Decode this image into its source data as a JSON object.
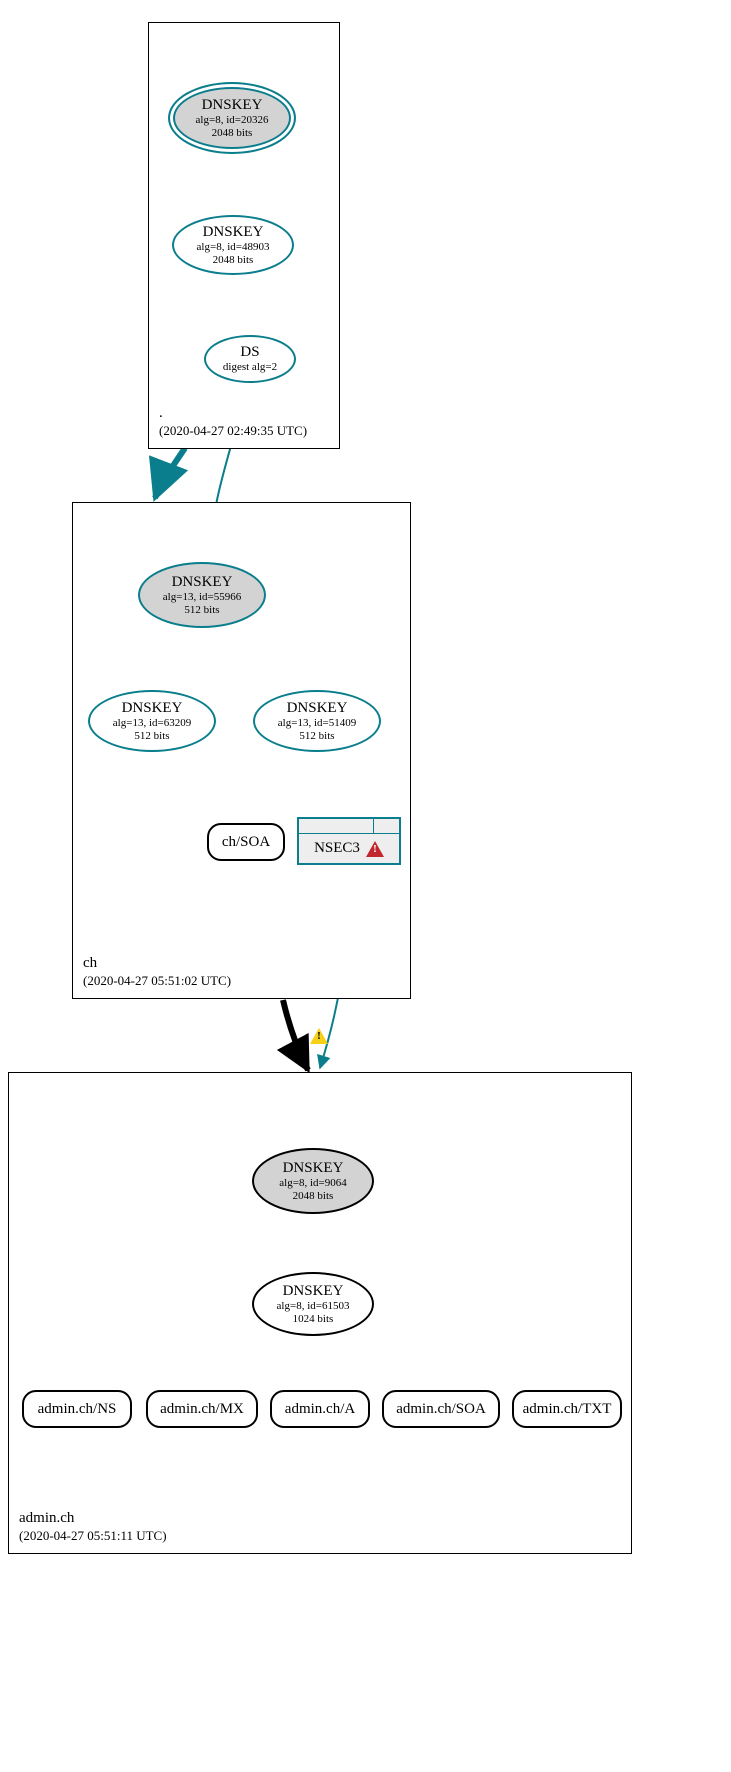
{
  "zones": {
    "root": {
      "name": ".",
      "timestamp": "(2020-04-27 02:49:35 UTC)"
    },
    "ch": {
      "name": "ch",
      "timestamp": "(2020-04-27 05:51:02 UTC)"
    },
    "admin": {
      "name": "admin.ch",
      "timestamp": "(2020-04-27 05:51:11 UTC)"
    }
  },
  "nodes": {
    "root_ksk": {
      "title": "DNSKEY",
      "line1": "alg=8, id=20326",
      "line2": "2048 bits"
    },
    "root_zsk": {
      "title": "DNSKEY",
      "line1": "alg=8, id=48903",
      "line2": "2048 bits"
    },
    "root_ds": {
      "title": "DS",
      "line1": "digest alg=2",
      "line2": ""
    },
    "ch_ksk": {
      "title": "DNSKEY",
      "line1": "alg=13, id=55966",
      "line2": "512 bits"
    },
    "ch_zsk1": {
      "title": "DNSKEY",
      "line1": "alg=13, id=63209",
      "line2": "512 bits"
    },
    "ch_zsk2": {
      "title": "DNSKEY",
      "line1": "alg=13, id=51409",
      "line2": "512 bits"
    },
    "ch_soa": {
      "title": "ch/SOA"
    },
    "nsec3": {
      "title": "NSEC3"
    },
    "admin_ksk": {
      "title": "DNSKEY",
      "line1": "alg=8, id=9064",
      "line2": "2048 bits"
    },
    "admin_zsk": {
      "title": "DNSKEY",
      "line1": "alg=8, id=61503",
      "line2": "1024 bits"
    },
    "rr_ns": {
      "title": "admin.ch/NS"
    },
    "rr_mx": {
      "title": "admin.ch/MX"
    },
    "rr_a": {
      "title": "admin.ch/A"
    },
    "rr_soa": {
      "title": "admin.ch/SOA"
    },
    "rr_txt": {
      "title": "admin.ch/TXT"
    }
  },
  "colors": {
    "teal": "#0a7e8c",
    "black": "#000000",
    "node_gray": "#d3d3d3",
    "warn_red": "#c1272d",
    "warn_yellow": "#f7d117"
  }
}
